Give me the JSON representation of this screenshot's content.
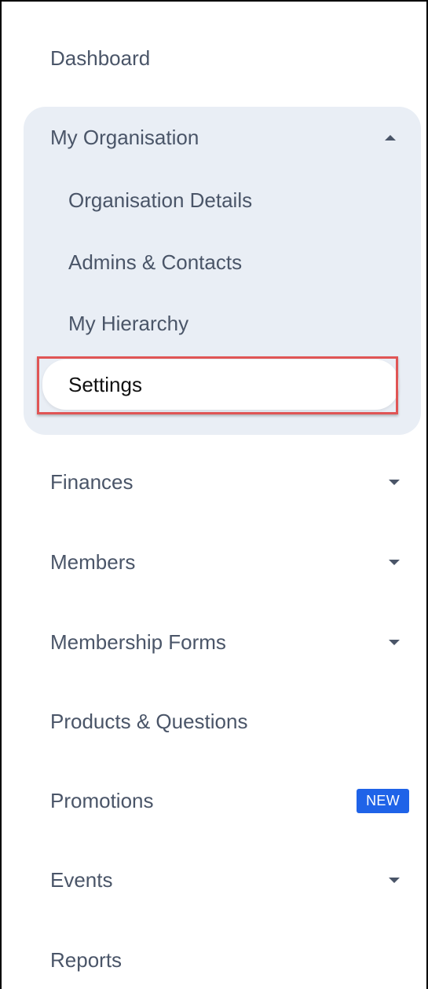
{
  "nav": {
    "dashboard": "Dashboard",
    "my_organisation": {
      "label": "My Organisation",
      "expanded": true,
      "items": [
        "Organisation Details",
        "Admins & Contacts",
        "My Hierarchy",
        "Settings"
      ],
      "active_item": "Settings"
    },
    "finances": "Finances",
    "members": "Members",
    "membership_forms": "Membership Forms",
    "products_questions": "Products & Questions",
    "promotions": {
      "label": "Promotions",
      "badge": "NEW"
    },
    "events": "Events",
    "reports": "Reports"
  },
  "icons": {
    "expand": "chevron-down-icon",
    "collapse": "chevron-up-icon"
  },
  "colors": {
    "text": "#4a5568",
    "active_text": "#111111",
    "group_background": "#e9eef5",
    "badge_background": "#1f63e8",
    "highlight_outline": "#e05555"
  }
}
